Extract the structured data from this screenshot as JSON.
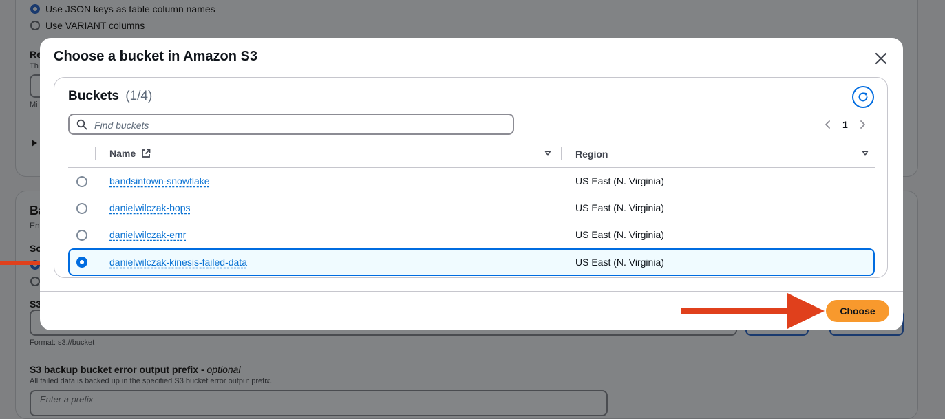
{
  "background": {
    "radio_json_keys": "Use JSON keys as table column names",
    "radio_variant": "Use VARIANT columns",
    "frag_re": "Re",
    "frag_th": "Th",
    "frag_mi": "Mi",
    "frag_ba": "Ba",
    "frag_en": "En",
    "frag_so": "So",
    "frag_s3": "S3",
    "format_hint": "Format: s3://bucket",
    "error_prefix_label": "S3 backup bucket error output prefix - ",
    "error_prefix_optional": "optional",
    "error_prefix_desc": "All failed data is backed up in the specified S3 bucket error output prefix.",
    "error_prefix_placeholder": "Enter a prefix"
  },
  "modal": {
    "title": "Choose a bucket in Amazon S3",
    "panel": {
      "header": "Buckets",
      "count": "(1/4)",
      "search_placeholder": "Find buckets",
      "pagination": {
        "current_page": "1"
      },
      "columns": {
        "name": "Name",
        "region": "Region"
      },
      "rows": [
        {
          "name": "bandsintown-snowflake",
          "region": "US East (N. Virginia)",
          "selected": false
        },
        {
          "name": "danielwilczak-bops",
          "region": "US East (N. Virginia)",
          "selected": false
        },
        {
          "name": "danielwilczak-emr",
          "region": "US East (N. Virginia)",
          "selected": false
        },
        {
          "name": "danielwilczak-kinesis-failed-data",
          "region": "US East (N. Virginia)",
          "selected": true
        }
      ]
    },
    "footer": {
      "choose_label": "Choose"
    }
  },
  "colors": {
    "primary": "#006ce0",
    "link": "#0972d3",
    "choose_button": "#f8992d",
    "annotation_arrow": "#e0401c",
    "overlay": "#7f8082"
  },
  "icons": [
    "close-icon",
    "refresh-icon",
    "search-icon",
    "chevron-left-icon",
    "chevron-right-icon",
    "external-link-icon",
    "sort-icon"
  ]
}
